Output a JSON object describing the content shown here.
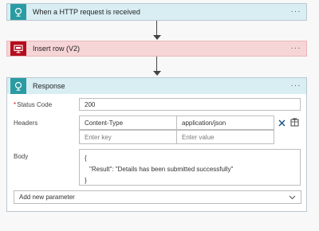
{
  "flow": {
    "trigger": {
      "title": "When a HTTP request is received",
      "icon": "http-request-icon",
      "menu": "···"
    },
    "insert": {
      "title": "Insert row (V2)",
      "icon": "sql-server-icon",
      "menu": "···"
    },
    "response": {
      "title": "Response",
      "icon": "response-icon",
      "menu": "···",
      "status_code": {
        "label": "Status Code",
        "required_mark": "*",
        "value": "200"
      },
      "headers": {
        "label": "Headers",
        "rows": [
          {
            "key": "Content-Type",
            "value": "application/json"
          },
          {
            "key_placeholder": "Enter key",
            "value_placeholder": "Enter value"
          }
        ]
      },
      "body": {
        "label": "Body",
        "lines": [
          "{",
          "\"Result\": \"Details has been submitted successfully\"",
          "}"
        ]
      },
      "add_parameter": {
        "label": "Add new parameter"
      }
    }
  },
  "colors": {
    "trigger_bg": "#d9eef3",
    "insert_bg": "#f6d5d6",
    "teal_icon": "#2b9ba3",
    "red_icon": "#b40d1e"
  }
}
